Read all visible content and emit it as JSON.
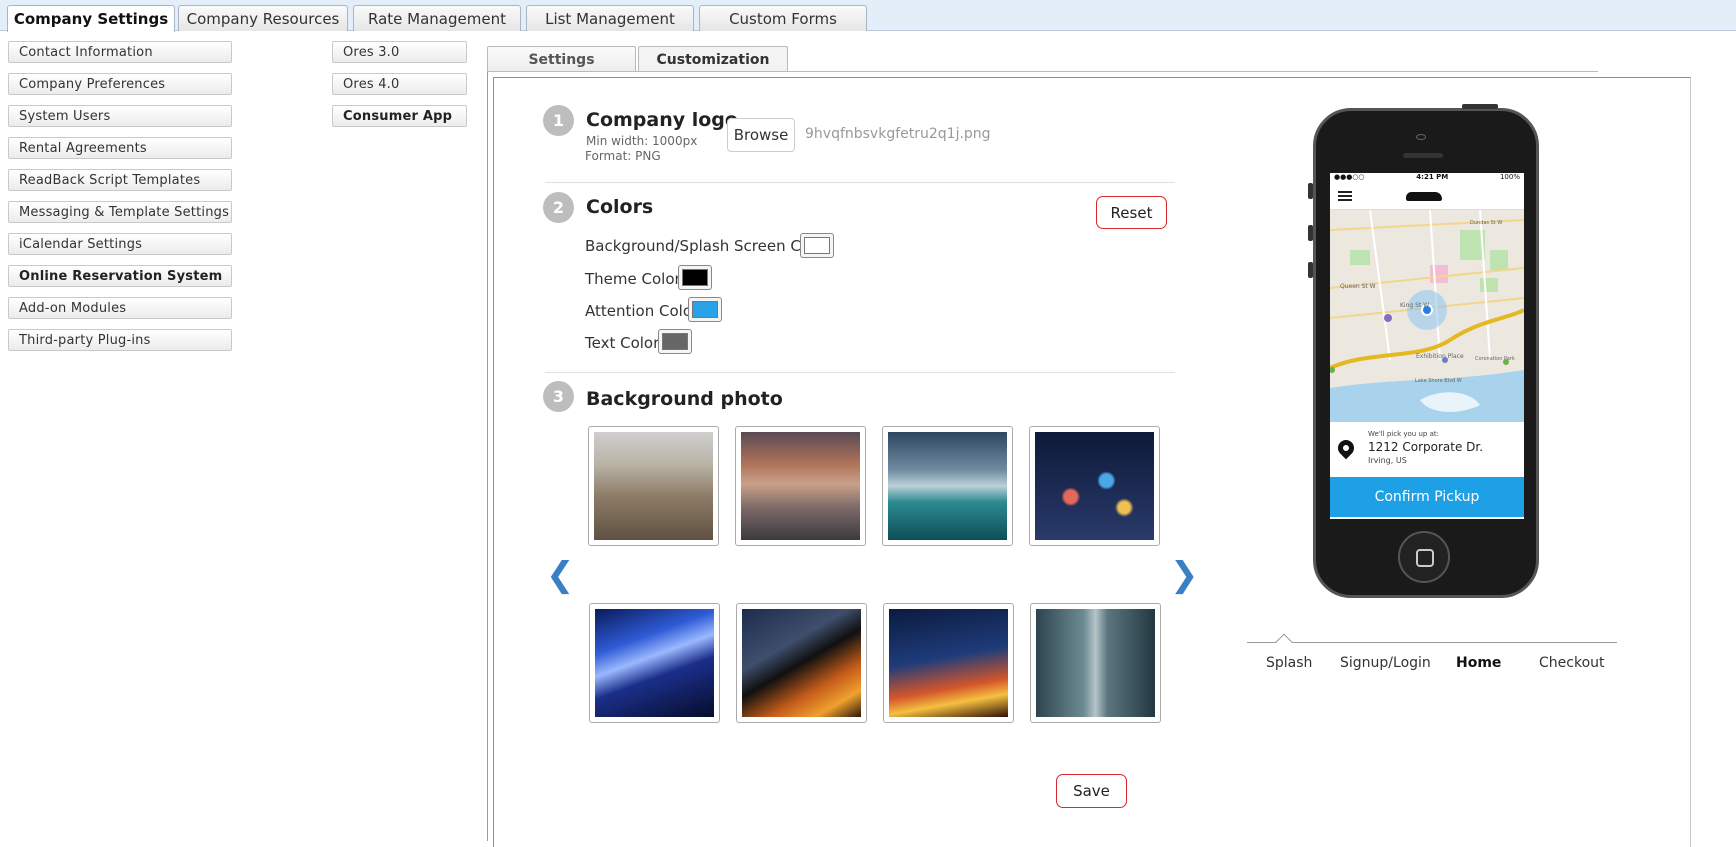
{
  "top_tabs": [
    "Company Settings",
    "Company Resources",
    "Rate Management",
    "List Management",
    "Custom Forms"
  ],
  "left_menu": [
    "Contact Information",
    "Company Preferences",
    "System Users",
    "Rental Agreements",
    "ReadBack Script Templates",
    "Messaging & Template Settings",
    "iCalendar Settings",
    "Online Reservation System",
    "Add-on Modules",
    "Third-party Plug-ins"
  ],
  "sub_menu": [
    "Ores 3.0",
    "Ores 4.0",
    "Consumer App"
  ],
  "sub_tabs": [
    "Settings",
    "Customization"
  ],
  "logo": {
    "step": "1",
    "title": "Company logo",
    "min_width": "Min width: 1000px",
    "format": "Format: PNG",
    "browse": "Browse",
    "filename": "9hvqfnbsvkgfetru2q1j.png"
  },
  "colors": {
    "step": "2",
    "title": "Colors",
    "reset": "Reset",
    "items": [
      {
        "label": "Background/Splash Screen Color:",
        "color": "#ffffff"
      },
      {
        "label": "Theme Color:",
        "color": "#000000"
      },
      {
        "label": "Attention Color:",
        "color": "#29a3e8"
      },
      {
        "label": "Text Color:",
        "color": "#666666"
      }
    ]
  },
  "background": {
    "step": "3",
    "title": "Background photo"
  },
  "save": "Save",
  "phone": {
    "time": "4:21 PM",
    "battery": "100%",
    "signal": "●●●○○",
    "pickup_caption": "We'll pick you up at:",
    "address": "1212 Corporate Dr.",
    "city": "Irving, US",
    "confirm": "Confirm Pickup",
    "map_labels": [
      "Queen St W",
      "King St W",
      "Exhibition Place",
      "Coronation Park",
      "Lake Shore Blvd W",
      "Dundas St W"
    ]
  },
  "phone_tabs": [
    "Splash",
    "Signup/Login",
    "Home",
    "Checkout"
  ],
  "accent_colors": {
    "red": "#d9272e",
    "blue": "#1ea0e6",
    "arrow": "#3a7fc4"
  }
}
